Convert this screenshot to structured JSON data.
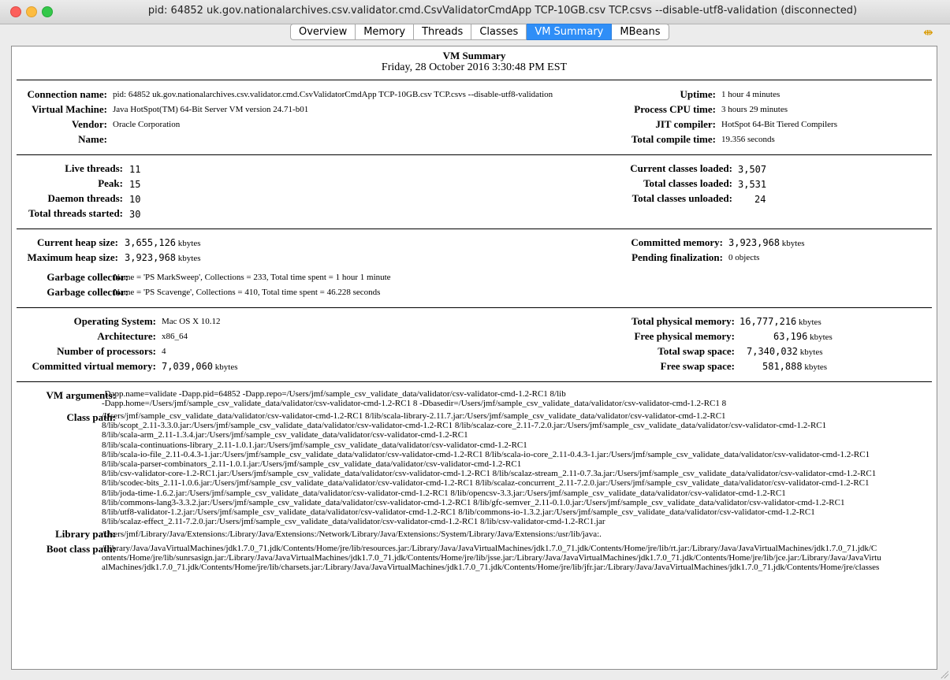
{
  "window": {
    "title": "pid: 64852 uk.gov.nationalarchives.csv.validator.cmd.CsvValidatorCmdApp TCP-10GB.csv TCP.csvs --disable-utf8-validation (disconnected)"
  },
  "tabs": [
    {
      "label": "Overview"
    },
    {
      "label": "Memory"
    },
    {
      "label": "Threads"
    },
    {
      "label": "Classes"
    },
    {
      "label": "VM Summary"
    },
    {
      "label": "MBeans"
    }
  ],
  "summary": {
    "title": "VM Summary",
    "date": "Friday, 28 October 2016 3:30:48 PM EST"
  },
  "section1": {
    "connection_label": "Connection name:",
    "connection_value": "pid: 64852 uk.gov.nationalarchives.csv.validator.cmd.CsvValidatorCmdApp TCP-10GB.csv TCP.csvs --disable-utf8-validation",
    "vm_label": "Virtual Machine:",
    "vm_value": "Java HotSpot(TM) 64-Bit Server VM version 24.71-b01",
    "vendor_label": "Vendor:",
    "vendor_value": "Oracle Corporation",
    "name_label": "Name:",
    "uptime_label": "Uptime:",
    "uptime_value": "1 hour 4 minutes",
    "cpu_label": "Process CPU time:",
    "cpu_value": "3 hours 29 minutes",
    "jit_label": "JIT compiler:",
    "jit_value": "HotSpot 64-Bit Tiered Compilers",
    "compile_label": "Total compile time:",
    "compile_value": "19.356 seconds"
  },
  "section2": {
    "live_label": "Live threads:",
    "live_value": "11",
    "peak_label": "Peak:",
    "peak_value": "15",
    "daemon_label": "Daemon threads:",
    "daemon_value": "10",
    "started_label": "Total threads started:",
    "started_value": "30",
    "cur_classes_label": "Current classes loaded:",
    "cur_classes_value": "3,507",
    "tot_classes_label": "Total classes loaded:",
    "tot_classes_value": "3,531",
    "unloaded_label": "Total classes unloaded:",
    "unloaded_value": "24"
  },
  "section3": {
    "heap_label": "Current heap size:",
    "heap_value": "3,655,126",
    "maxheap_label": "Maximum heap size:",
    "maxheap_value": "3,923,968",
    "committed_label": "Committed memory:",
    "committed_value": "3,923,968",
    "pending_label": "Pending finalization:",
    "pending_value": "0 objects",
    "unit": "kbytes",
    "gc_label": "Garbage collector:",
    "gc1_value": "Name = 'PS MarkSweep', Collections = 233, Total time spent = 1 hour 1 minute",
    "gc2_value": "Name = 'PS Scavenge', Collections = 410, Total time spent = 46.228 seconds"
  },
  "section4": {
    "os_label": "Operating System:",
    "os_value": "Mac OS X 10.12",
    "arch_label": "Architecture:",
    "arch_value": "x86_64",
    "proc_label": "Number of processors:",
    "proc_value": "4",
    "cvm_label": "Committed virtual memory:",
    "cvm_value": "7,039,060",
    "tpm_label": "Total physical memory:",
    "tpm_value": "16,777,216",
    "fpm_label": "Free physical memory:",
    "fpm_value": "63,196",
    "tss_label": "Total swap space:",
    "tss_value": "7,340,032",
    "fss_label": "Free swap space:",
    "fss_value": "581,888"
  },
  "section5": {
    "vmargs_label": "VM arguments:",
    "vmargs_value": "-Dapp.name=validate -Dapp.pid=64852 -Dapp.repo=/Users/jmf/sample_csv_validate_data/validator/csv-validator-cmd-1.2-RC1 8/lib\n-Dapp.home=/Users/jmf/sample_csv_validate_data/validator/csv-validator-cmd-1.2-RC1 8 -Dbasedir=/Users/jmf/sample_csv_validate_data/validator/csv-validator-cmd-1.2-RC1 8",
    "classpath_label": "Class path:",
    "classpath_value": "/Users/jmf/sample_csv_validate_data/validator/csv-validator-cmd-1.2-RC1 8/lib/scala-library-2.11.7.jar:/Users/jmf/sample_csv_validate_data/validator/csv-validator-cmd-1.2-RC1\n8/lib/scopt_2.11-3.3.0.jar:/Users/jmf/sample_csv_validate_data/validator/csv-validator-cmd-1.2-RC1 8/lib/scalaz-core_2.11-7.2.0.jar:/Users/jmf/sample_csv_validate_data/validator/csv-validator-cmd-1.2-RC1\n8/lib/scala-arm_2.11-1.3.4.jar:/Users/jmf/sample_csv_validate_data/validator/csv-validator-cmd-1.2-RC1\n8/lib/scala-continuations-library_2.11-1.0.1.jar:/Users/jmf/sample_csv_validate_data/validator/csv-validator-cmd-1.2-RC1\n8/lib/scala-io-file_2.11-0.4.3-1.jar:/Users/jmf/sample_csv_validate_data/validator/csv-validator-cmd-1.2-RC1 8/lib/scala-io-core_2.11-0.4.3-1.jar:/Users/jmf/sample_csv_validate_data/validator/csv-validator-cmd-1.2-RC1\n8/lib/scala-parser-combinators_2.11-1.0.1.jar:/Users/jmf/sample_csv_validate_data/validator/csv-validator-cmd-1.2-RC1\n8/lib/csv-validator-core-1.2-RC1.jar:/Users/jmf/sample_csv_validate_data/validator/csv-validator-cmd-1.2-RC1 8/lib/scalaz-stream_2.11-0.7.3a.jar:/Users/jmf/sample_csv_validate_data/validator/csv-validator-cmd-1.2-RC1\n8/lib/scodec-bits_2.11-1.0.6.jar:/Users/jmf/sample_csv_validate_data/validator/csv-validator-cmd-1.2-RC1 8/lib/scalaz-concurrent_2.11-7.2.0.jar:/Users/jmf/sample_csv_validate_data/validator/csv-validator-cmd-1.2-RC1\n8/lib/joda-time-1.6.2.jar:/Users/jmf/sample_csv_validate_data/validator/csv-validator-cmd-1.2-RC1 8/lib/opencsv-3.3.jar:/Users/jmf/sample_csv_validate_data/validator/csv-validator-cmd-1.2-RC1\n8/lib/commons-lang3-3.3.2.jar:/Users/jmf/sample_csv_validate_data/validator/csv-validator-cmd-1.2-RC1 8/lib/gfc-semver_2.11-0.1.0.jar:/Users/jmf/sample_csv_validate_data/validator/csv-validator-cmd-1.2-RC1\n8/lib/utf8-validator-1.2.jar:/Users/jmf/sample_csv_validate_data/validator/csv-validator-cmd-1.2-RC1 8/lib/commons-io-1.3.2.jar:/Users/jmf/sample_csv_validate_data/validator/csv-validator-cmd-1.2-RC1\n8/lib/scalaz-effect_2.11-7.2.0.jar:/Users/jmf/sample_csv_validate_data/validator/csv-validator-cmd-1.2-RC1 8/lib/csv-validator-cmd-1.2-RC1.jar",
    "libpath_label": "Library path:",
    "libpath_value": "/Users/jmf/Library/Java/Extensions:/Library/Java/Extensions:/Network/Library/Java/Extensions:/System/Library/Java/Extensions:/usr/lib/java:.",
    "bootpath_label": "Boot class path:",
    "bootpath_value": "/Library/Java/JavaVirtualMachines/jdk1.7.0_71.jdk/Contents/Home/jre/lib/resources.jar:/Library/Java/JavaVirtualMachines/jdk1.7.0_71.jdk/Contents/Home/jre/lib/rt.jar:/Library/Java/JavaVirtualMachines/jdk1.7.0_71.jdk/C\nontents/Home/jre/lib/sunrsasign.jar:/Library/Java/JavaVirtualMachines/jdk1.7.0_71.jdk/Contents/Home/jre/lib/jsse.jar:/Library/Java/JavaVirtualMachines/jdk1.7.0_71.jdk/Contents/Home/jre/lib/jce.jar:/Library/Java/JavaVirtu\nalMachines/jdk1.7.0_71.jdk/Contents/Home/jre/lib/charsets.jar:/Library/Java/JavaVirtualMachines/jdk1.7.0_71.jdk/Contents/Home/jre/lib/jfr.jar:/Library/Java/JavaVirtualMachines/jdk1.7.0_71.jdk/Contents/Home/jre/classes"
  }
}
